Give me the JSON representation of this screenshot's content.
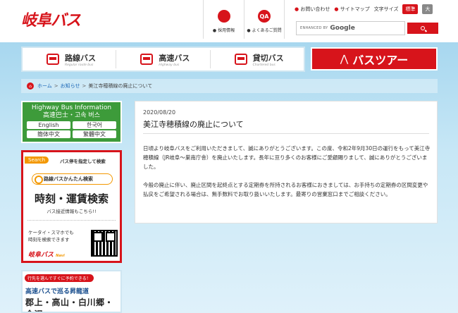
{
  "header": {
    "logo": "岐阜バス",
    "links": [
      {
        "icon": "person-icon",
        "glyph": "●",
        "label": "● 採用情報"
      },
      {
        "icon": "qa-icon",
        "glyph": "QA",
        "label": "● よくあるご質問"
      }
    ],
    "util": {
      "contact": "お問い合わせ",
      "sitemap": "サイトマップ",
      "fontsize_label": "文字サイズ",
      "fs_standard": "標準",
      "fs_large": "大"
    },
    "search": {
      "brand": "ENHANCED BY",
      "google": "Google"
    }
  },
  "nav": {
    "items": [
      {
        "title": "路線バス",
        "sub": "Regular route bus"
      },
      {
        "title": "高速バス",
        "sub": "Highway bus"
      },
      {
        "title": "貸切バス",
        "sub": "Chartered bus"
      }
    ],
    "tour": "バスツアー"
  },
  "breadcrumb": {
    "home": "ホーム",
    "news": "お知らせ",
    "current": "美江寺穂積線の廃止について",
    "sep": ">"
  },
  "sidebar": {
    "highway": {
      "title": "Highway Bus Information",
      "sub": "高速巴士・고속 버스",
      "langs": [
        "English",
        "한국어",
        "簡体中文",
        "繁體中文"
      ]
    },
    "search_card": {
      "tag": "Search",
      "tag_text": "バス停を指定して検索",
      "pill": "路線バスかんたん検索",
      "big": "時刻・運賃検索",
      "note": "バス接近情報もこちら!!",
      "mobile1": "ケータイ・スマホでも",
      "mobile2": "時刻を検索できます",
      "logo": "岐阜バス",
      "logo_small": "Navi"
    },
    "promo": {
      "top": "行先を選んですぐに予約できる！",
      "line1": "高速バスで巡る昇龍道",
      "line2": "郡上・高山・白川郷・金沢"
    }
  },
  "article": {
    "date": "2020/08/20",
    "title": "美江寺穂積線の廃止について",
    "paragraph1": "日頃より岐阜バスをご利用いただきまして、誠にありがとうございます。この度、令和2年9月30日の運行をもって美江寺穂積線（JR岐阜〜巣南庁舎）を廃止いたします。長年に亘り多くのお客様にご愛顧賜りまして、誠にありがとうございました。",
    "paragraph2": "今般の廃止に伴い、廃止区間を起終点とする定期券を所持されるお客様におきましては、お手持ちの定期券の区間変更や払戻をご希望される場合は、無手数料でお取り扱いいたします。最寄りの営業窓口までご相談ください。"
  }
}
